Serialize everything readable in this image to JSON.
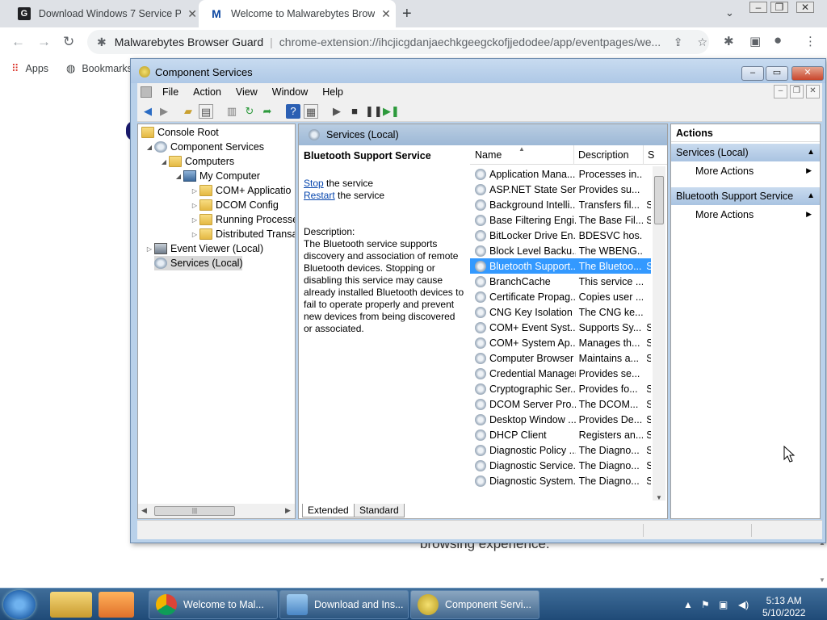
{
  "browser": {
    "tabs": [
      {
        "favicon": "G",
        "title": "Download Windows 7 Service Pa",
        "close": "✕"
      },
      {
        "favicon": "M",
        "title": "Welcome to Malwarebytes Brow",
        "close": "✕"
      }
    ],
    "new_tab": "+",
    "omnibox": {
      "site": "Malwarebytes Browser Guard",
      "url": "chrome-extension://ihcjicgdanjaechkgeegckofjjedodee/app/eventpages/we..."
    },
    "bookmarks": {
      "apps": "Apps",
      "bookmarks": "Bookmarks"
    },
    "page_text": "browsing experience."
  },
  "mmc": {
    "title": "Component Services",
    "menu": [
      "File",
      "Action",
      "View",
      "Window",
      "Help"
    ],
    "tree": {
      "console_root": "Console Root",
      "component_services": "Component Services",
      "computers": "Computers",
      "my_computer": "My Computer",
      "com_plus": "COM+ Applicatio",
      "dcom_config": "DCOM Config",
      "running_processes": "Running Processe",
      "distributed": "Distributed Transa",
      "event_viewer": "Event Viewer (Local)",
      "services_local": "Services (Local)"
    },
    "center": {
      "header": "Services (Local)",
      "service_title": "Bluetooth Support Service",
      "stop_link": "Stop",
      "stop_suffix": " the service",
      "restart_link": "Restart",
      "restart_suffix": " the service",
      "description_label": "Description:",
      "description": "The Bluetooth service supports discovery and association of remote Bluetooth devices.  Stopping or disabling this service may cause already installed Bluetooth devices to fail to operate properly and prevent new devices from being discovered or associated."
    },
    "list": {
      "columns": {
        "name": "Name",
        "description": "Description",
        "status": "S"
      },
      "rows": [
        {
          "name": "Application Mana...",
          "desc": "Processes in...",
          "status": ""
        },
        {
          "name": "ASP.NET State Ser...",
          "desc": "Provides su...",
          "status": ""
        },
        {
          "name": "Background Intelli...",
          "desc": "Transfers fil...",
          "status": "S"
        },
        {
          "name": "Base Filtering Engi...",
          "desc": "The Base Fil...",
          "status": "S"
        },
        {
          "name": "BitLocker Drive En...",
          "desc": "BDESVC hos...",
          "status": ""
        },
        {
          "name": "Block Level Backu...",
          "desc": "The WBENG...",
          "status": ""
        },
        {
          "name": "Bluetooth Support...",
          "desc": "The Bluetoo...",
          "status": "S"
        },
        {
          "name": "BranchCache",
          "desc": "This service ...",
          "status": ""
        },
        {
          "name": "Certificate Propag...",
          "desc": "Copies user ...",
          "status": ""
        },
        {
          "name": "CNG Key Isolation",
          "desc": "The CNG ke...",
          "status": ""
        },
        {
          "name": "COM+ Event Syst...",
          "desc": "Supports Sy...",
          "status": "S"
        },
        {
          "name": "COM+ System Ap...",
          "desc": "Manages th...",
          "status": "S"
        },
        {
          "name": "Computer Browser",
          "desc": "Maintains a...",
          "status": "S"
        },
        {
          "name": "Credential Manager",
          "desc": "Provides se...",
          "status": ""
        },
        {
          "name": "Cryptographic Ser...",
          "desc": "Provides fo...",
          "status": "S"
        },
        {
          "name": "DCOM Server Pro...",
          "desc": "The DCOM...",
          "status": "S"
        },
        {
          "name": "Desktop Window ...",
          "desc": "Provides De...",
          "status": "S"
        },
        {
          "name": "DHCP Client",
          "desc": "Registers an...",
          "status": "S"
        },
        {
          "name": "Diagnostic Policy ...",
          "desc": "The Diagno...",
          "status": "S"
        },
        {
          "name": "Diagnostic Service...",
          "desc": "The Diagno...",
          "status": "S"
        },
        {
          "name": "Diagnostic System...",
          "desc": "The Diagno...",
          "status": "S"
        }
      ],
      "selected_index": 6
    },
    "view_tabs": [
      "Extended",
      "Standard"
    ],
    "actions": {
      "header": "Actions",
      "group1": "Services (Local)",
      "group1_item": "More Actions",
      "group2": "Bluetooth Support Service",
      "group2_item": "More Actions"
    }
  },
  "taskbar": {
    "tasks": [
      {
        "title": "Welcome to Mal..."
      },
      {
        "title": "Download and Ins..."
      },
      {
        "title": "Component Servi..."
      }
    ],
    "time": "5:13 AM",
    "date": "5/10/2022"
  }
}
